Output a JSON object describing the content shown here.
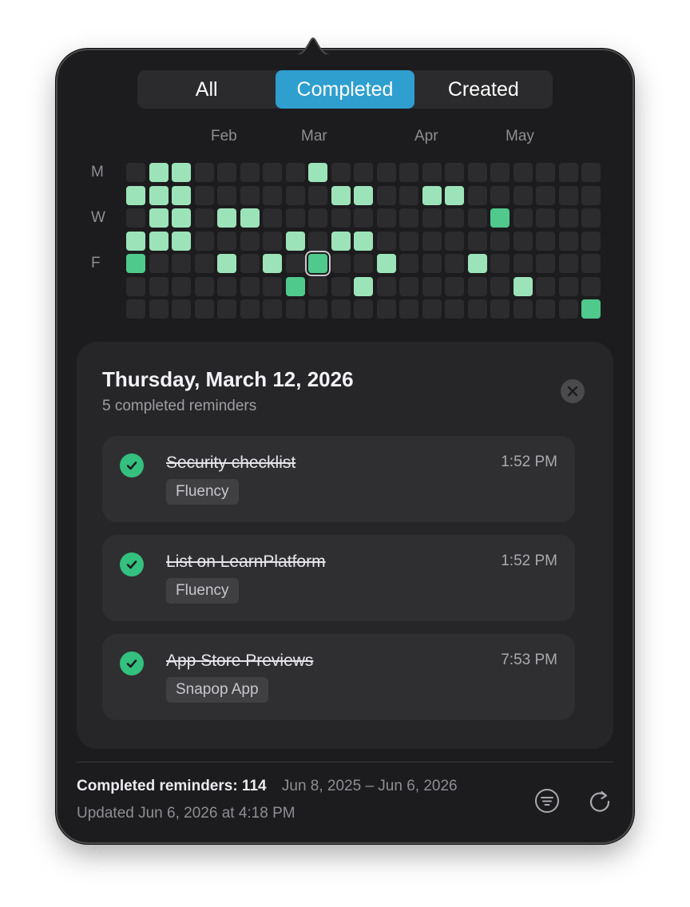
{
  "tabs": [
    {
      "label": "All",
      "active": false
    },
    {
      "label": "Completed",
      "active": true
    },
    {
      "label": "Created",
      "active": false
    }
  ],
  "months": [
    "Feb",
    "Mar",
    "Apr",
    "May"
  ],
  "weekday_labels": [
    "M",
    "W",
    "F"
  ],
  "colors": {
    "accent": "#2f9fd0",
    "level0": "#2c2c2e",
    "level1": "#9ce3b9",
    "level2": "#4fc98c",
    "check": "#34c07f"
  },
  "activity_grid": {
    "columns": 21,
    "rows": 7,
    "selected": {
      "row": 4,
      "col": 8
    },
    "levels": [
      [
        0,
        2,
        2,
        0,
        0,
        0,
        0,
        0,
        2,
        0,
        0,
        0,
        0,
        0,
        0,
        0,
        0,
        0,
        0,
        0,
        0
      ],
      [
        2,
        2,
        2,
        0,
        0,
        0,
        0,
        0,
        0,
        2,
        2,
        0,
        0,
        2,
        2,
        0,
        0,
        0,
        0,
        0,
        0
      ],
      [
        0,
        2,
        2,
        0,
        2,
        2,
        0,
        0,
        0,
        0,
        0,
        0,
        0,
        0,
        0,
        0,
        3,
        0,
        0,
        0,
        0
      ],
      [
        2,
        2,
        2,
        0,
        0,
        0,
        0,
        2,
        0,
        2,
        2,
        0,
        0,
        0,
        0,
        0,
        0,
        0,
        0,
        0,
        0
      ],
      [
        3,
        0,
        0,
        0,
        2,
        0,
        2,
        0,
        3,
        0,
        0,
        2,
        0,
        0,
        0,
        2,
        0,
        0,
        0,
        0,
        0
      ],
      [
        0,
        0,
        0,
        0,
        0,
        0,
        0,
        3,
        0,
        0,
        2,
        0,
        0,
        0,
        0,
        0,
        0,
        2,
        0,
        0,
        0
      ],
      [
        0,
        0,
        0,
        0,
        0,
        0,
        0,
        0,
        0,
        0,
        0,
        0,
        0,
        0,
        0,
        0,
        0,
        0,
        0,
        0,
        3
      ]
    ]
  },
  "detail": {
    "title": "Thursday, March 12, 2026",
    "subtitle": "5 completed reminders",
    "reminders": [
      {
        "title": "Security checklist",
        "time": "1:52 PM",
        "tag": "Fluency"
      },
      {
        "title": "List on LearnPlatform",
        "time": "1:52 PM",
        "tag": "Fluency"
      },
      {
        "title": "App Store Previews",
        "time": "7:53 PM",
        "tag": "Snapop App"
      }
    ]
  },
  "footer": {
    "count_label": "Completed reminders: 114",
    "range": "Jun 8, 2025 – Jun 6, 2026",
    "updated": "Updated Jun 6, 2026 at 4:18 PM",
    "icons": [
      "filter-icon",
      "refresh-icon"
    ]
  }
}
